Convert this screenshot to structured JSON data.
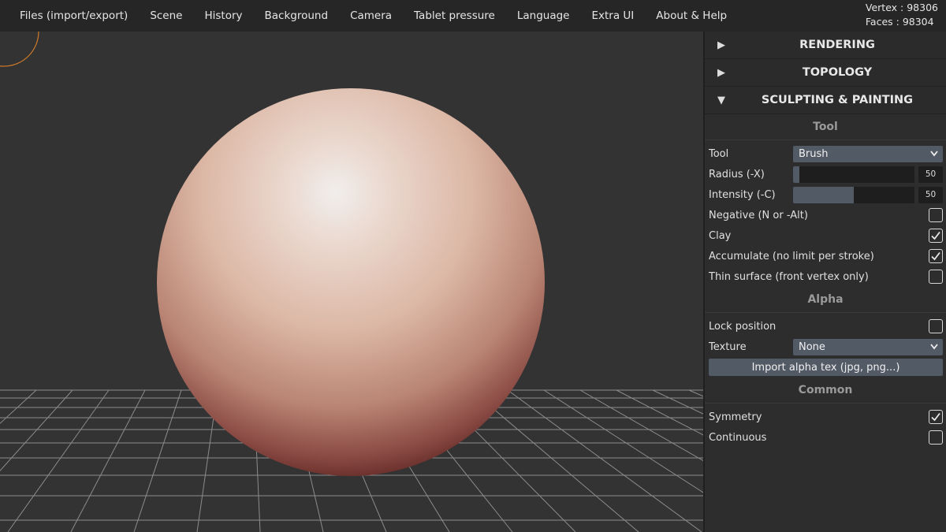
{
  "menubar": {
    "items": [
      "Files (import/export)",
      "Scene",
      "History",
      "Background",
      "Camera",
      "Tablet pressure",
      "Language",
      "Extra UI",
      "About & Help"
    ]
  },
  "stats": {
    "vertex": "Vertex : 98306",
    "faces": "Faces : 98304"
  },
  "colors": {
    "background": "#333333",
    "panel": "#2d2d2d",
    "control": "#525a66",
    "accent_cursor": "#d07a2a"
  },
  "panel": {
    "sections": [
      {
        "label": "RENDERING",
        "expanded": false,
        "arrow": "▶"
      },
      {
        "label": "TOPOLOGY",
        "expanded": false,
        "arrow": "▶"
      },
      {
        "label": "SCULPTING & PAINTING",
        "expanded": true,
        "arrow": "▼"
      }
    ],
    "tool_group": {
      "heading": "Tool",
      "tool_label": "Tool",
      "tool_value": "Brush",
      "radius_label": "Radius (-X)",
      "radius_value": "50",
      "radius_fraction": 0.05,
      "intensity_label": "Intensity (-C)",
      "intensity_value": "50",
      "intensity_fraction": 0.5,
      "negative_label": "Negative (N or -Alt)",
      "negative_checked": false,
      "clay_label": "Clay",
      "clay_checked": true,
      "accumulate_label": "Accumulate (no limit per stroke)",
      "accumulate_checked": true,
      "thin_label": "Thin surface (front vertex only)",
      "thin_checked": false
    },
    "alpha_group": {
      "heading": "Alpha",
      "lock_label": "Lock position",
      "lock_checked": false,
      "texture_label": "Texture",
      "texture_value": "None",
      "import_label": "Import alpha tex (jpg, png...)"
    },
    "common_group": {
      "heading": "Common",
      "symmetry_label": "Symmetry",
      "symmetry_checked": true,
      "continuous_label": "Continuous",
      "continuous_checked": false
    }
  }
}
